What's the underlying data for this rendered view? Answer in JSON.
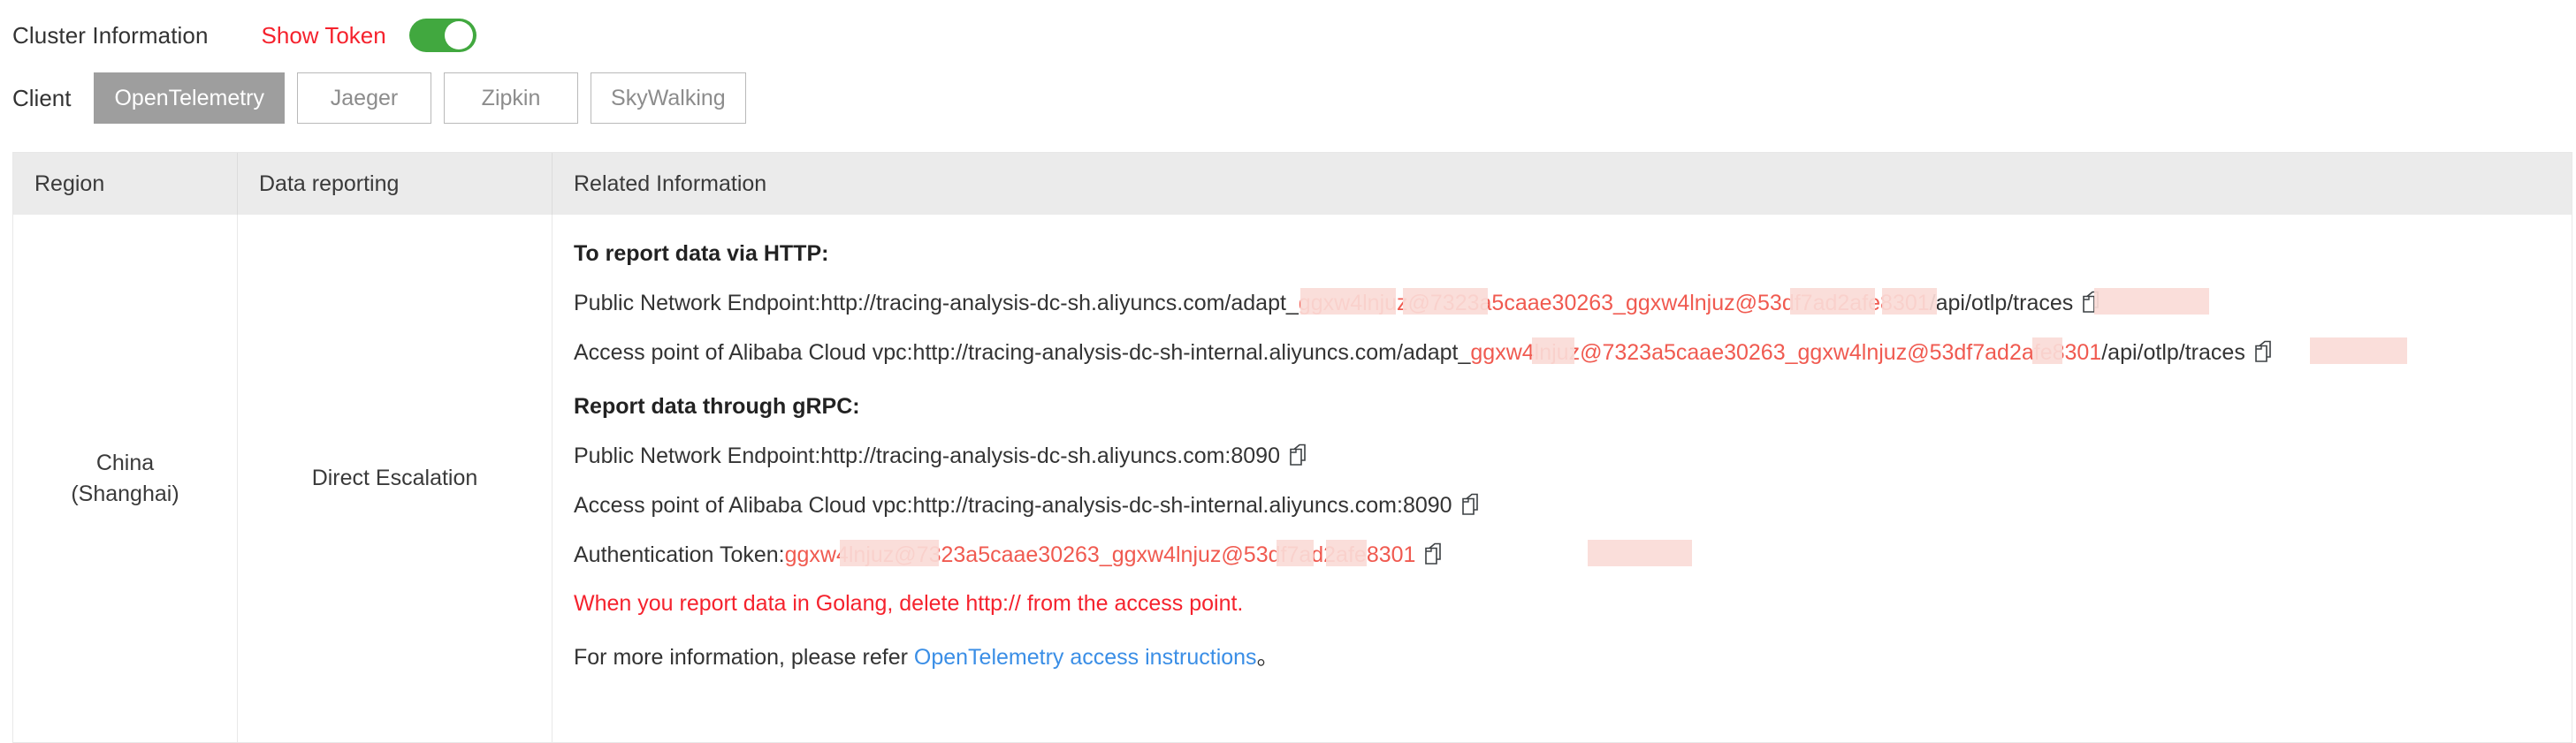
{
  "header": {
    "cluster_title": "Cluster Information",
    "show_token_label": "Show Token",
    "show_token_on": true,
    "accent_red": "#f5222d",
    "switch_green": "#41a83f"
  },
  "client_selector": {
    "label": "Client",
    "selected": "OpenTelemetry",
    "options": [
      {
        "label": "OpenTelemetry",
        "active": true
      },
      {
        "label": "Jaeger",
        "active": false
      },
      {
        "label": "Zipkin",
        "active": false
      },
      {
        "label": "SkyWalking",
        "active": false
      }
    ]
  },
  "table": {
    "columns": [
      "Region",
      "Data reporting",
      "Related Information"
    ],
    "rows": [
      {
        "region": "China\n(Shanghai)",
        "region_line1": "China",
        "region_line2": "(Shanghai)",
        "data_reporting": "Direct Escalation",
        "related": {
          "http_title": "To report data via HTTP:",
          "http_public_prefix": "Public Network Endpoint:http://tracing-analysis-dc-sh.aliyuncs.com/adapt_",
          "http_public_token": "ggxw4lnjuz@7323a5caae30263_ggxw4lnjuz@53df7ad2afe8301",
          "http_public_suffix": "/api/otlp/traces",
          "http_vpc_prefix": "Access point of Alibaba Cloud vpc:http://tracing-analysis-dc-sh-internal.aliyuncs.com/adapt_",
          "http_vpc_token": "ggxw4lnjuz@7323a5caae30263_ggxw4lnjuz@53df7ad2afe8301",
          "http_vpc_suffix": "/api/otlp/traces",
          "grpc_title": "Report data through gRPC:",
          "grpc_public": "Public Network Endpoint:http://tracing-analysis-dc-sh.aliyuncs.com:8090",
          "grpc_vpc": "Access point of Alibaba Cloud vpc:http://tracing-analysis-dc-sh-internal.aliyuncs.com:8090",
          "auth_token_prefix": "Authentication Token:",
          "auth_token_value": "ggxw4lnjuz@7323a5caae30263_ggxw4lnjuz@53df7ad2afe8301",
          "golang_warning": "When you report data in Golang, delete http:// from the access point.",
          "refer_prefix": "For more information, please refer ",
          "refer_link": "OpenTelemetry access instructions",
          "refer_suffix": "。"
        }
      }
    ]
  },
  "icons": {
    "copy": "copy-icon"
  }
}
